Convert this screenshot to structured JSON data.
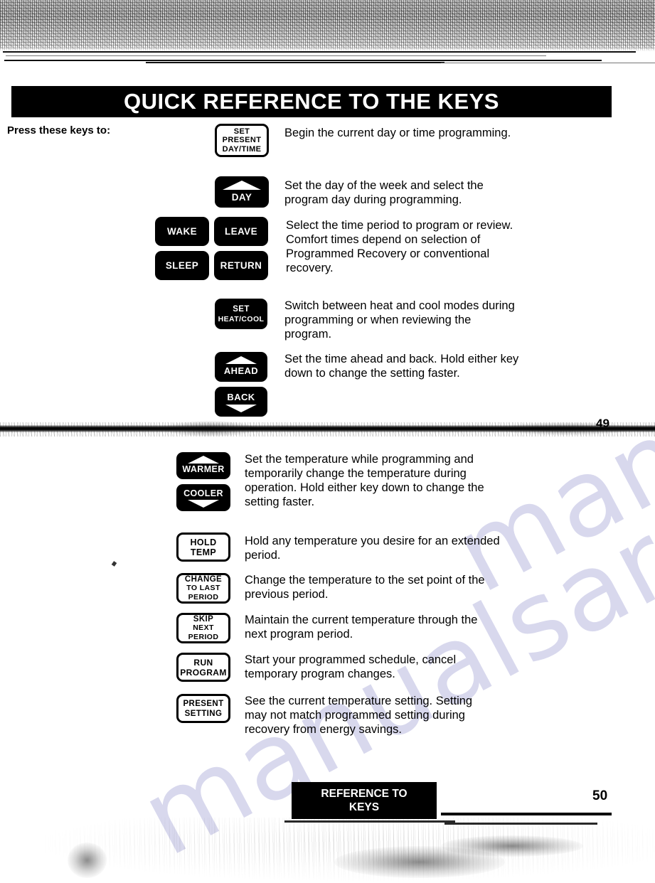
{
  "document": {
    "title": "QUICK REFERENCE TO THE KEYS",
    "press_label": "Press these keys to:",
    "watermark_text": "manualsarchive.com"
  },
  "page_top": {
    "page_number": "49",
    "entries": [
      {
        "keys": [
          {
            "id": "set-present-day-time",
            "style": "outline",
            "lines": [
              "SET",
              "PRESENT",
              "DAY/TIME"
            ],
            "arrow": "none"
          }
        ],
        "description": "Begin the current day or time programming."
      },
      {
        "keys": [
          {
            "id": "day",
            "style": "solid",
            "lines": [
              "DAY"
            ],
            "arrow": "up"
          }
        ],
        "description": "Set the day of the week and select the program day during programming."
      },
      {
        "keys": [
          {
            "id": "wake",
            "style": "solid",
            "lines": [
              "WAKE"
            ],
            "arrow": "none"
          },
          {
            "id": "leave",
            "style": "solid",
            "lines": [
              "LEAVE"
            ],
            "arrow": "none"
          },
          {
            "id": "sleep",
            "style": "solid",
            "lines": [
              "SLEEP"
            ],
            "arrow": "none"
          },
          {
            "id": "return",
            "style": "solid",
            "lines": [
              "RETURN"
            ],
            "arrow": "none"
          }
        ],
        "description": "Select the time period to program or review. Comfort times depend on selection of Programmed Recovery or conventional recovery."
      },
      {
        "keys": [
          {
            "id": "set-heat-cool",
            "style": "solid",
            "lines": [
              "SET",
              "HEAT/COOL"
            ],
            "arrow": "none"
          }
        ],
        "description": "Switch between heat and cool modes during programming or when reviewing the program."
      },
      {
        "keys": [
          {
            "id": "ahead",
            "style": "solid",
            "lines": [
              "AHEAD"
            ],
            "arrow": "up"
          },
          {
            "id": "back",
            "style": "solid",
            "lines": [
              "BACK"
            ],
            "arrow": "down"
          }
        ],
        "description": "Set the time ahead and back. Hold either key down to change the setting faster."
      }
    ]
  },
  "page_bottom": {
    "page_number": "50",
    "footer_line1": "REFERENCE TO",
    "footer_line2": "KEYS",
    "entries": [
      {
        "keys": [
          {
            "id": "warmer",
            "style": "solid",
            "lines": [
              "WARMER"
            ],
            "arrow": "up"
          },
          {
            "id": "cooler",
            "style": "solid",
            "lines": [
              "COOLER"
            ],
            "arrow": "down"
          }
        ],
        "description": "Set the temperature while programming and temporarily change the temperature during operation. Hold either key down to change the setting faster."
      },
      {
        "keys": [
          {
            "id": "hold-temp",
            "style": "outline",
            "lines": [
              "HOLD",
              "TEMP"
            ],
            "arrow": "none"
          }
        ],
        "description": "Hold any temperature you desire for an extended period."
      },
      {
        "keys": [
          {
            "id": "change-to-last-period",
            "style": "outline",
            "lines": [
              "CHANGE",
              "TO LAST",
              "PERIOD"
            ],
            "arrow": "none"
          }
        ],
        "description": "Change the temperature to the set point of the previous period."
      },
      {
        "keys": [
          {
            "id": "skip-next-period",
            "style": "outline",
            "lines": [
              "SKIP",
              "NEXT",
              "PERIOD"
            ],
            "arrow": "none"
          }
        ],
        "description": "Maintain the current temperature through the next program period."
      },
      {
        "keys": [
          {
            "id": "run-program",
            "style": "outline",
            "lines": [
              "RUN",
              "PROGRAM"
            ],
            "arrow": "none"
          }
        ],
        "description": "Start your programmed schedule, cancel temporary program changes."
      },
      {
        "keys": [
          {
            "id": "present-setting",
            "style": "outline",
            "lines": [
              "PRESENT",
              "SETTING"
            ],
            "arrow": "none"
          }
        ],
        "description": "See the current temperature setting. Setting may not match programmed setting during recovery from energy savings."
      }
    ]
  }
}
